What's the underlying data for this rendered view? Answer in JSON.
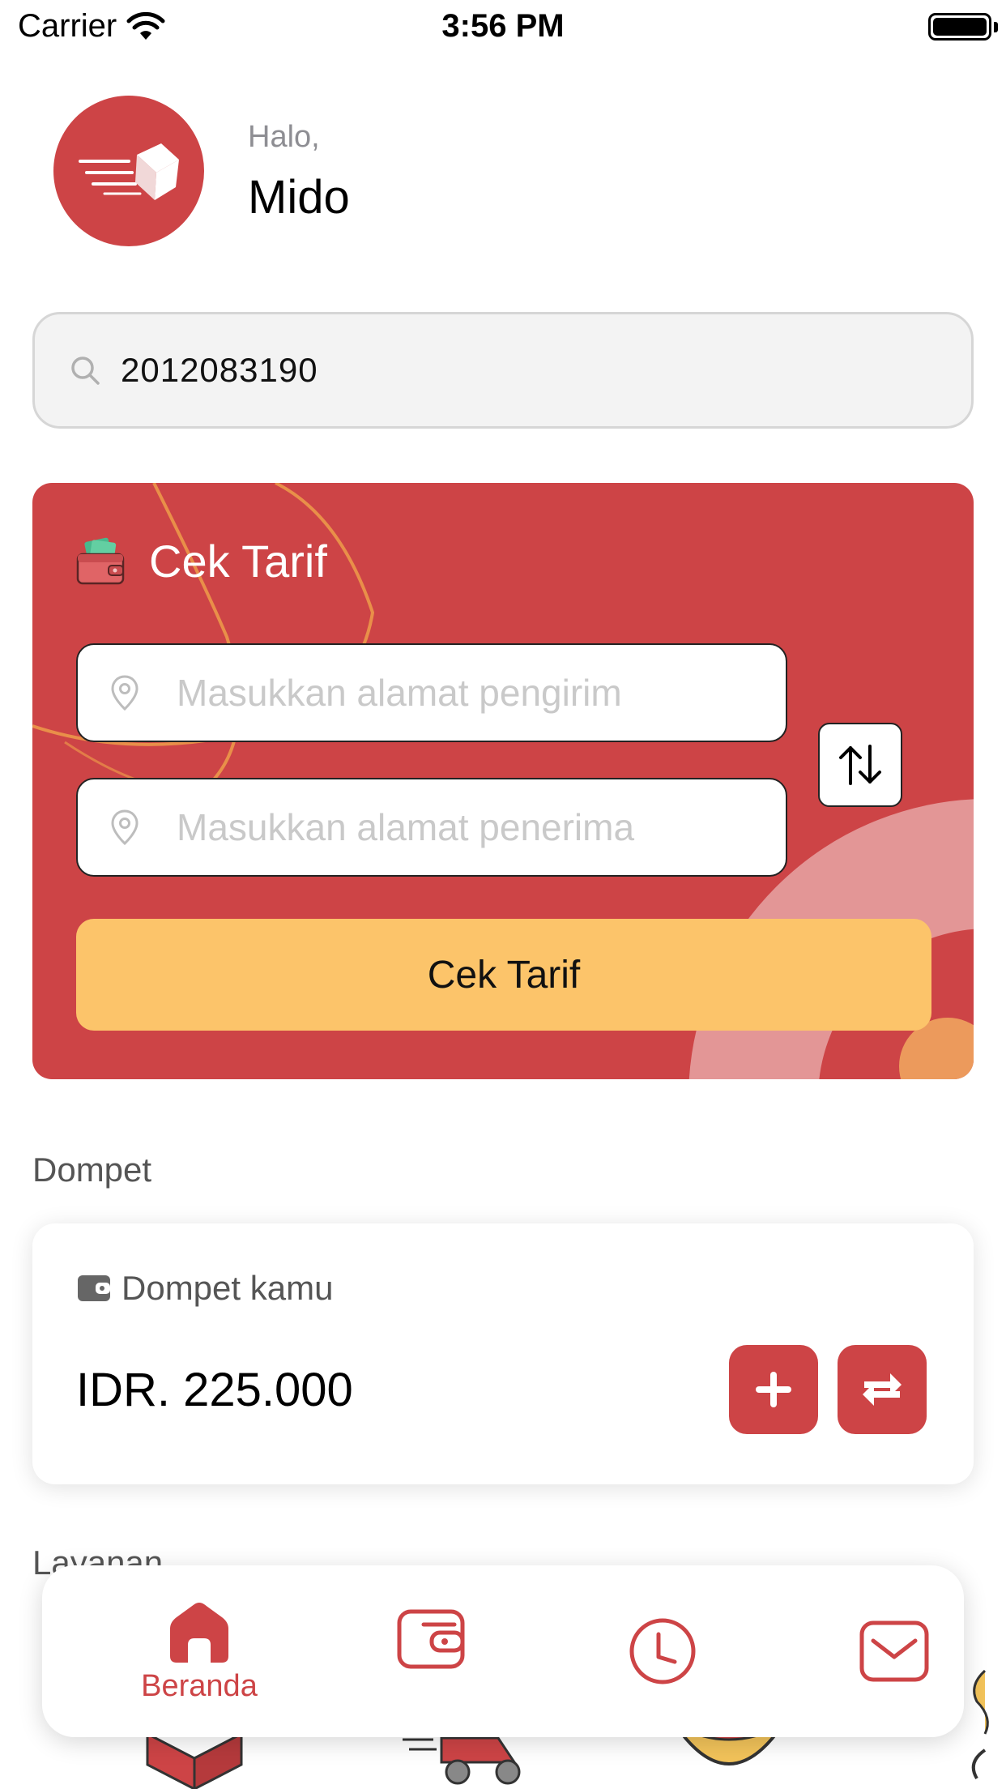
{
  "status_bar": {
    "carrier": "Carrier",
    "time": "3:56 PM"
  },
  "header": {
    "greeting": "Halo,",
    "name": "Mido"
  },
  "search": {
    "value": "2012083190",
    "icon": "search-icon"
  },
  "tarif_card": {
    "title": "Cek Tarif",
    "sender_placeholder": "Masukkan alamat pengirim",
    "receiver_placeholder": "Masukkan alamat penerima",
    "button_label": "Cek Tarif",
    "swap_symbol": "↑↓"
  },
  "wallet": {
    "section_title": "Dompet",
    "label": "Dompet kamu",
    "amount": "IDR. 225.000"
  },
  "services": {
    "section_title": "Layanan"
  },
  "tab_bar": {
    "items": [
      {
        "label": "Beranda",
        "icon": "home-icon",
        "active": true
      },
      {
        "label": "",
        "icon": "wallet-icon",
        "active": false
      },
      {
        "label": "",
        "icon": "clock-icon",
        "active": false
      },
      {
        "label": "",
        "icon": "mail-icon",
        "active": false
      }
    ]
  },
  "colors": {
    "brand_red": "#cd4446",
    "button_yellow": "#fcc46a",
    "muted_text": "#8e8e93"
  }
}
